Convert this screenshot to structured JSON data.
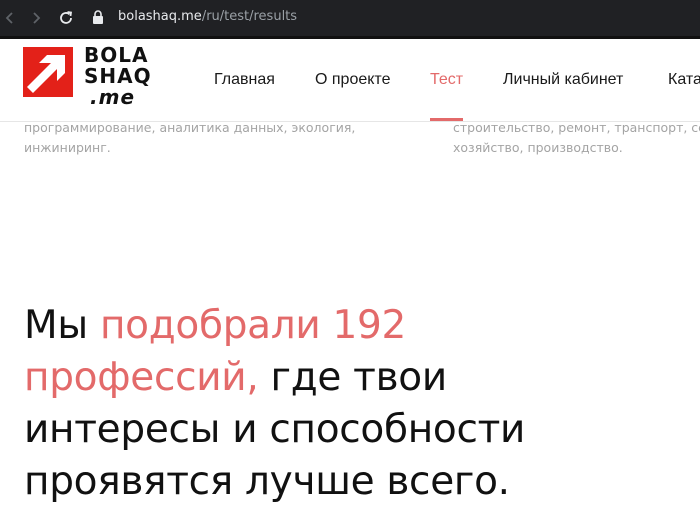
{
  "browser": {
    "url_host": "bolashaq.me",
    "url_path": "/ru/test/results"
  },
  "logo": {
    "line1": "BOLA",
    "line2": "SHAQ",
    "line3": ".me",
    "mark_color": "#e32119"
  },
  "nav": {
    "items": [
      {
        "label": "Главная"
      },
      {
        "label": "О проекте"
      },
      {
        "label": "Тест"
      },
      {
        "label": "Личный кабинет"
      },
      {
        "label": "Ката"
      }
    ],
    "active_index": 2,
    "accent_color": "#e36a6a"
  },
  "descriptions": {
    "left": [
      "программирование, аналитика данных, экология,",
      "инжиниринг."
    ],
    "right": [
      "строительство, ремонт, транспорт, сел",
      "хозяйство, производство."
    ]
  },
  "headline": {
    "plain1": "Мы ",
    "accent1": "подобрали 192",
    "accent2": "профессий,",
    "plain2": " где твои",
    "line3": "интересы и способности",
    "line4": "проявятся лучше всего."
  }
}
